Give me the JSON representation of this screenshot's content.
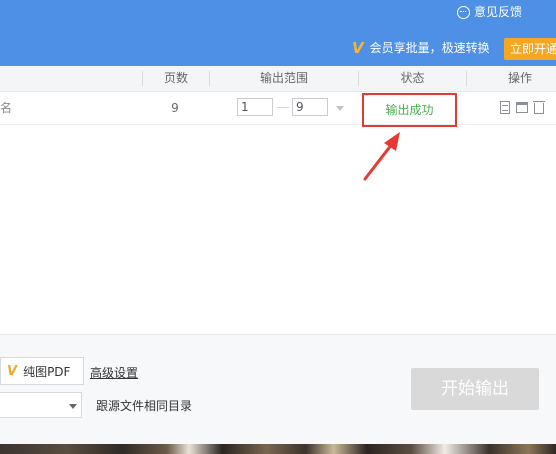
{
  "topbar": {
    "feedback_label": "意见反馈",
    "promo_text": "会员享批量，极速转换",
    "open_vip_label": "立即开通"
  },
  "table": {
    "columns": {
      "pages": "页数",
      "range": "输出范围",
      "status": "状态",
      "ops": "操作"
    },
    "rows": [
      {
        "filename_partial": "名",
        "pages": "9",
        "range_from": "1",
        "range_to": "9",
        "status": "输出成功"
      }
    ]
  },
  "bottom": {
    "pure_pdf_label": "纯图PDF",
    "advanced_settings_label": "高级设置",
    "output_dir_label": "跟源文件相同目录",
    "start_button_label": "开始输出"
  },
  "colors": {
    "topbar": "#4d90e6",
    "vip_orange": "#f5a623",
    "status_success": "#4caf50",
    "highlight_red": "#e53935",
    "disabled_button": "#d9d9d9"
  }
}
